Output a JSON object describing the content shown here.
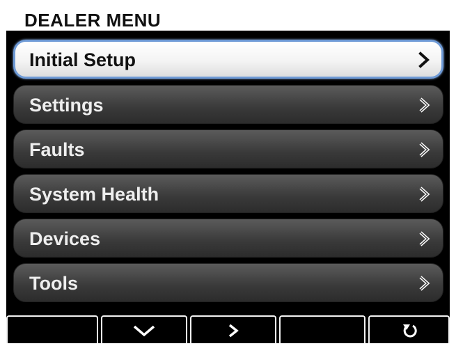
{
  "header": {
    "title": "DEALER MENU"
  },
  "menu": {
    "items": [
      {
        "label": "Initial Setup",
        "selected": true,
        "icon": "chevron-right-icon"
      },
      {
        "label": "Settings",
        "selected": false,
        "icon": "chevron-right-icon"
      },
      {
        "label": "Faults",
        "selected": false,
        "icon": "chevron-right-icon"
      },
      {
        "label": "System Health",
        "selected": false,
        "icon": "chevron-right-icon"
      },
      {
        "label": "Devices",
        "selected": false,
        "icon": "chevron-right-icon"
      },
      {
        "label": "Tools",
        "selected": false,
        "icon": "chevron-right-icon"
      }
    ]
  },
  "softkeys": [
    {
      "icon": "none"
    },
    {
      "icon": "chevron-down-icon"
    },
    {
      "icon": "chevron-right-icon"
    },
    {
      "icon": "none"
    },
    {
      "icon": "back-arrow-icon"
    }
  ],
  "colors": {
    "screen_background": "#000000",
    "header_background": "#ffffff",
    "selection_border": "#6e9ad6",
    "item_text": "#eeeeee",
    "selected_item_text": "#111111"
  }
}
